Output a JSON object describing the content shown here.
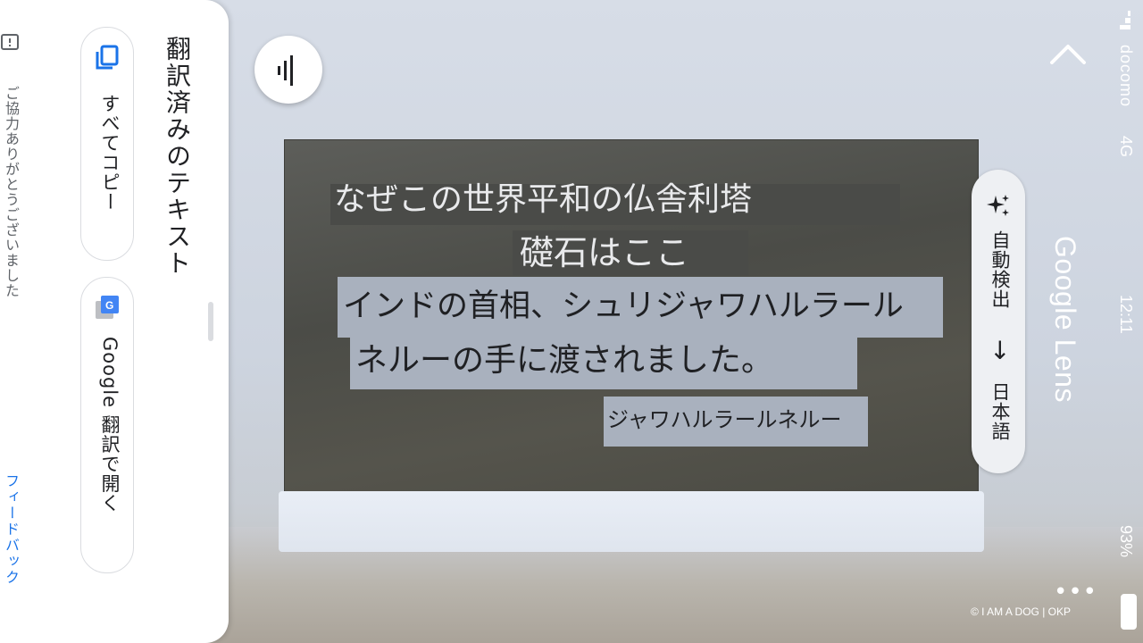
{
  "panel": {
    "title": "翻訳済みのテキスト",
    "copy_all_label": "すべてコピー",
    "open_in_google_translate_label": "Google 翻訳で開く",
    "thanks_text": "ご協力ありがとうございました",
    "feedback_link": "フィードバック"
  },
  "overlays": {
    "line1": "なぜこの世界平和の仏舎利塔",
    "line2": "礎石はここ",
    "line3": "インドの首相、シュリジャワハルラール",
    "line4": "ネルーの手に渡されました。",
    "line5": "ジャワハルラールネルー"
  },
  "lens": {
    "source_language": "自動検出",
    "arrow": "→",
    "target_language": "日本語",
    "app_title": "Google Lens"
  },
  "status_bar": {
    "carrier": "docomo",
    "network": "4G",
    "time": "12:11",
    "battery": "93%"
  },
  "more_icon": "more-dots-icon",
  "credit": "© I AM A DOG | OKP",
  "colors": {
    "accent": "#1a73e8",
    "dark_overlay": "#4a4b48",
    "light_overlay": "#a9b1be"
  }
}
